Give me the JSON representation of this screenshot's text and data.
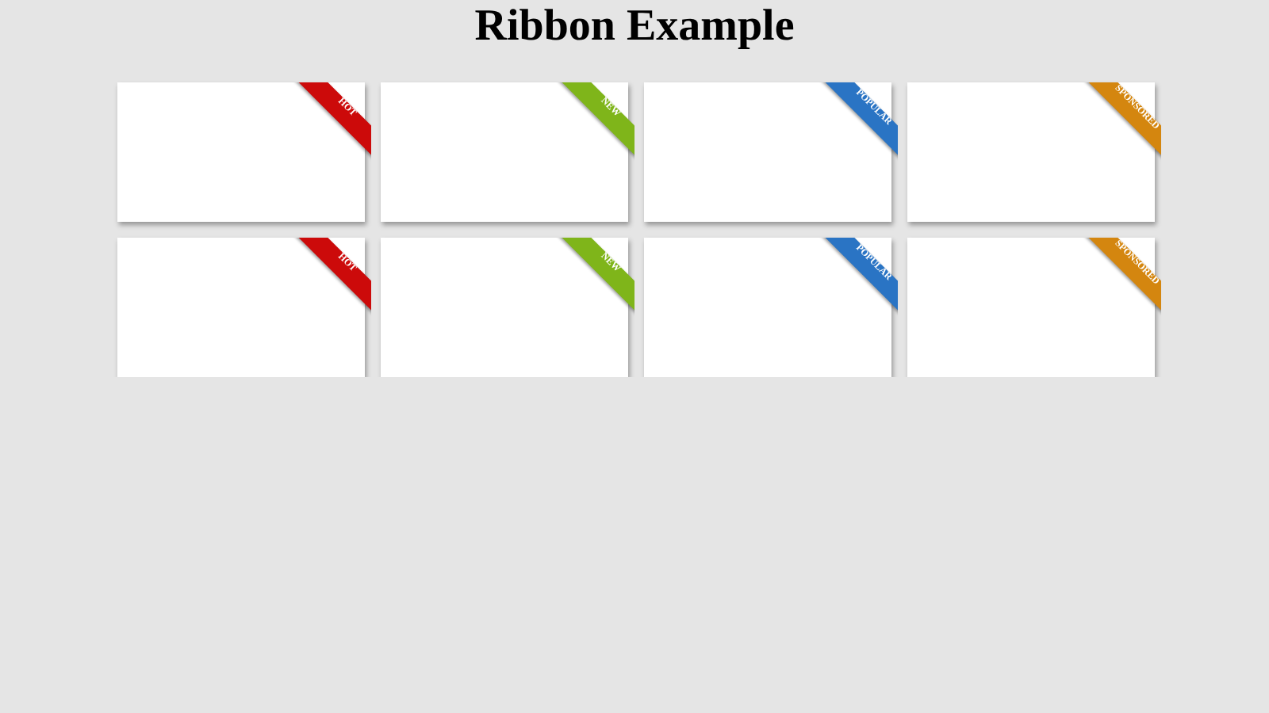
{
  "title": "Ribbon Example",
  "cards": [
    {
      "ribbon": "HOT",
      "color": "#cc0a0a"
    },
    {
      "ribbon": "NEW",
      "color": "#7fb51a"
    },
    {
      "ribbon": "POPULAR",
      "color": "#2a74c4"
    },
    {
      "ribbon": "SPONSORED",
      "color": "#d4860f"
    },
    {
      "ribbon": "HOT",
      "color": "#cc0a0a"
    },
    {
      "ribbon": "NEW",
      "color": "#7fb51a"
    },
    {
      "ribbon": "POPULAR",
      "color": "#2a74c4"
    },
    {
      "ribbon": "SPONSORED",
      "color": "#d4860f"
    }
  ]
}
